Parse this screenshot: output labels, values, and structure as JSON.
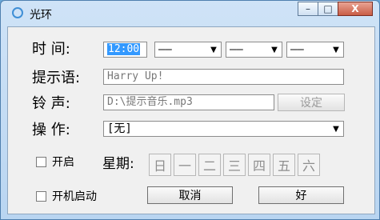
{
  "window": {
    "title": "光环",
    "buttons": {
      "minimize": "–",
      "maximize": "□",
      "close": "X"
    }
  },
  "form": {
    "time_label": "时 间:",
    "time_hour": "12:00",
    "time_fields": [
      "——",
      "——",
      "——"
    ],
    "reminder_label": "提示语:",
    "reminder_text": "Harry Up!",
    "sound_label": "铃 声:",
    "sound_path": "D:\\提示音乐.mp3",
    "sound_button": "设定",
    "action_label": "操 作:",
    "action_value": "[无]",
    "enable_label": "开启",
    "week_label": "星期:",
    "weekdays": [
      "日",
      "一",
      "二",
      "三",
      "四",
      "五",
      "六"
    ],
    "autostart_label": "开机启动",
    "cancel_button": "取消",
    "ok_button": "好"
  }
}
